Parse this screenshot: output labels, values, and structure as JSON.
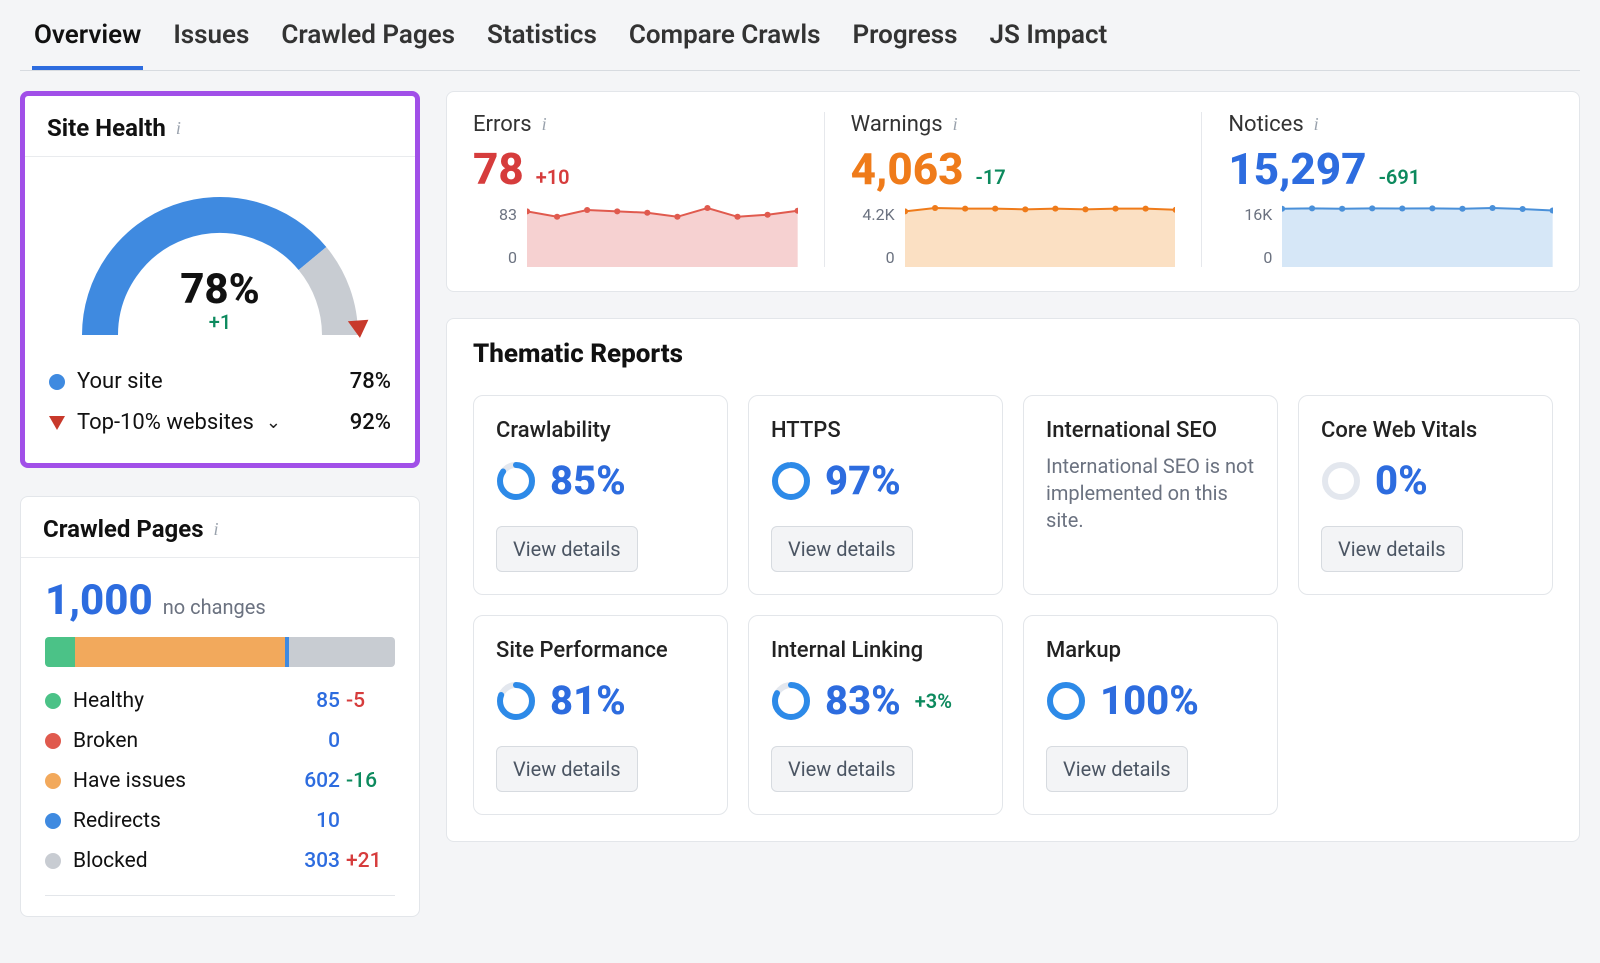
{
  "tabs": [
    "Overview",
    "Issues",
    "Crawled Pages",
    "Statistics",
    "Compare Crawls",
    "Progress",
    "JS Impact"
  ],
  "tabs_active_index": 0,
  "site_health": {
    "title": "Site Health",
    "value_pct": 78,
    "value_label": "78%",
    "delta_label": "+1",
    "your_site_label": "Your site",
    "your_site_pct": "78%",
    "top10_label": "Top-10% websites",
    "top10_pct": "92%"
  },
  "crawled_pages": {
    "title": "Crawled Pages",
    "count": "1,000",
    "sub": "no changes",
    "segments": [
      {
        "name": "Healthy",
        "color": "#4bc287",
        "width_pct": 8.5
      },
      {
        "name": "Have issues",
        "color": "#f2a95c",
        "width_pct": 60.2
      },
      {
        "name": "Redirects",
        "color": "#3f8ae0",
        "width_pct": 1.0
      },
      {
        "name": "Blocked",
        "color": "#c8ccd2",
        "width_pct": 30.3
      }
    ],
    "rows": [
      {
        "label": "Healthy",
        "color": "#4bc287",
        "value": "85",
        "delta": "-5",
        "delta_class": "c-neg"
      },
      {
        "label": "Broken",
        "color": "#e05a4e",
        "value": "0",
        "delta": "",
        "delta_class": ""
      },
      {
        "label": "Have issues",
        "color": "#f2a95c",
        "value": "602",
        "delta": "-16",
        "delta_class": "c-pos"
      },
      {
        "label": "Redirects",
        "color": "#3f8ae0",
        "value": "10",
        "delta": "",
        "delta_class": ""
      },
      {
        "label": "Blocked",
        "color": "#c8ccd2",
        "value": "303",
        "delta": "+21",
        "delta_class": "c-neg"
      }
    ]
  },
  "metrics": [
    {
      "id": "errors",
      "title": "Errors",
      "value": "78",
      "value_class": "c-err",
      "delta": "+10",
      "delta_class": "c-err",
      "axis_top": "83",
      "axis_bot": "0",
      "fill": "#f6d1d1",
      "stroke": "#e05a4e",
      "points": [
        78,
        70,
        80,
        78,
        76,
        70,
        83,
        70,
        73,
        79
      ]
    },
    {
      "id": "warnings",
      "title": "Warnings",
      "value": "4,063",
      "value_class": "c-warn",
      "delta": "-17",
      "delta_class": "c-pos",
      "axis_top": "4.2K",
      "axis_bot": "0",
      "fill": "#fbe0c3",
      "stroke": "#ef7b1a",
      "points": [
        3950,
        4200,
        4150,
        4150,
        4100,
        4150,
        4100,
        4150,
        4150,
        4063
      ]
    },
    {
      "id": "notices",
      "title": "Notices",
      "value": "15,297",
      "value_class": "c-note",
      "delta": "-691",
      "delta_class": "c-pos",
      "axis_top": "16K",
      "axis_bot": "0",
      "fill": "#d6e7f7",
      "stroke": "#4a90d9",
      "points": [
        15800,
        15900,
        15800,
        15900,
        15850,
        15900,
        15800,
        16000,
        15700,
        15297
      ]
    }
  ],
  "thematic": {
    "title": "Thematic Reports",
    "view_details_label": "View details",
    "cards": [
      {
        "title": "Crawlability",
        "pct": 85,
        "pct_label": "85%",
        "delta": "",
        "ring_color": "#2d8ae8",
        "show_button": true
      },
      {
        "title": "HTTPS",
        "pct": 97,
        "pct_label": "97%",
        "delta": "",
        "ring_color": "#2d8ae8",
        "show_button": true
      },
      {
        "title": "International SEO",
        "pct": null,
        "pct_label": "",
        "delta": "",
        "ring_color": "",
        "show_button": false,
        "message": "International SEO is not implemented on this site."
      },
      {
        "title": "Core Web Vitals",
        "pct": 0,
        "pct_label": "0%",
        "delta": "",
        "ring_color": "#c8ccd2",
        "show_button": true
      },
      {
        "title": "Site Performance",
        "pct": 81,
        "pct_label": "81%",
        "delta": "",
        "ring_color": "#2d8ae8",
        "show_button": true
      },
      {
        "title": "Internal Linking",
        "pct": 83,
        "pct_label": "83%",
        "delta": "+3%",
        "ring_color": "#2d8ae8",
        "show_button": true
      },
      {
        "title": "Markup",
        "pct": 100,
        "pct_label": "100%",
        "delta": "",
        "ring_color": "#2d8ae8",
        "show_button": true
      }
    ]
  },
  "chart_data": {
    "gauge": {
      "type": "gauge",
      "value": 78,
      "max": 100,
      "delta": 1,
      "label": "Site Health"
    },
    "sparklines": [
      {
        "type": "line",
        "name": "Errors",
        "ylim": [
          0,
          83
        ],
        "values": [
          78,
          70,
          80,
          78,
          76,
          70,
          83,
          70,
          73,
          79
        ]
      },
      {
        "type": "line",
        "name": "Warnings",
        "ylim": [
          0,
          4200
        ],
        "values": [
          3950,
          4200,
          4150,
          4150,
          4100,
          4150,
          4100,
          4150,
          4150,
          4063
        ]
      },
      {
        "type": "line",
        "name": "Notices",
        "ylim": [
          0,
          16000
        ],
        "values": [
          15800,
          15900,
          15800,
          15900,
          15850,
          15900,
          15800,
          16000,
          15700,
          15297
        ]
      }
    ],
    "crawled_bar": {
      "type": "bar",
      "orientation": "stacked-horizontal",
      "categories": [
        "Healthy",
        "Broken",
        "Have issues",
        "Redirects",
        "Blocked"
      ],
      "values": [
        85,
        0,
        602,
        10,
        303
      ],
      "total": 1000
    },
    "thematic_rings": {
      "type": "pie",
      "series": [
        {
          "name": "Crawlability",
          "values": [
            85,
            15
          ]
        },
        {
          "name": "HTTPS",
          "values": [
            97,
            3
          ]
        },
        {
          "name": "Core Web Vitals",
          "values": [
            0,
            100
          ]
        },
        {
          "name": "Site Performance",
          "values": [
            81,
            19
          ]
        },
        {
          "name": "Internal Linking",
          "values": [
            83,
            17
          ]
        },
        {
          "name": "Markup",
          "values": [
            100,
            0
          ]
        }
      ]
    }
  }
}
